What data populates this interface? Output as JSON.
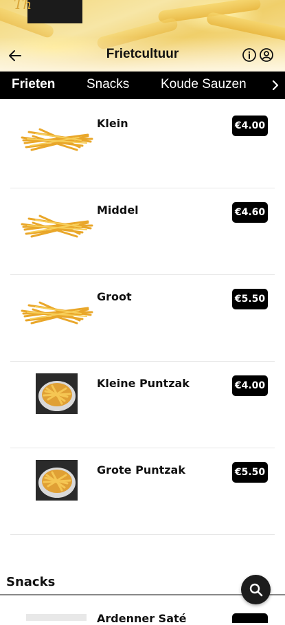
{
  "header": {
    "title": "Frietcultuur"
  },
  "tabs": [
    {
      "label": "Frieten",
      "active": true
    },
    {
      "label": "Snacks",
      "active": false
    },
    {
      "label": "Koude Sauzen",
      "active": false
    }
  ],
  "products": [
    {
      "name": "Klein",
      "price": "€4.00",
      "image": "fries"
    },
    {
      "name": "Middel",
      "price": "€4.60",
      "image": "fries"
    },
    {
      "name": "Groot",
      "price": "€5.50",
      "image": "fries"
    },
    {
      "name": "Kleine Puntzak",
      "price": "€4.00",
      "image": "cone"
    },
    {
      "name": "Grote Puntzak",
      "price": "€5.50",
      "image": "cone"
    }
  ],
  "sections": {
    "snacks_title": "Snacks"
  },
  "next_product": {
    "name": "Ardenner Saté"
  },
  "icons": {
    "back": "arrow-left-icon",
    "info": "info-icon",
    "user": "user-circle-icon",
    "tabs_more": "chevron-right-icon",
    "search": "search-icon"
  },
  "colors": {
    "accent": "#000000",
    "price_text": "#ffffff"
  }
}
